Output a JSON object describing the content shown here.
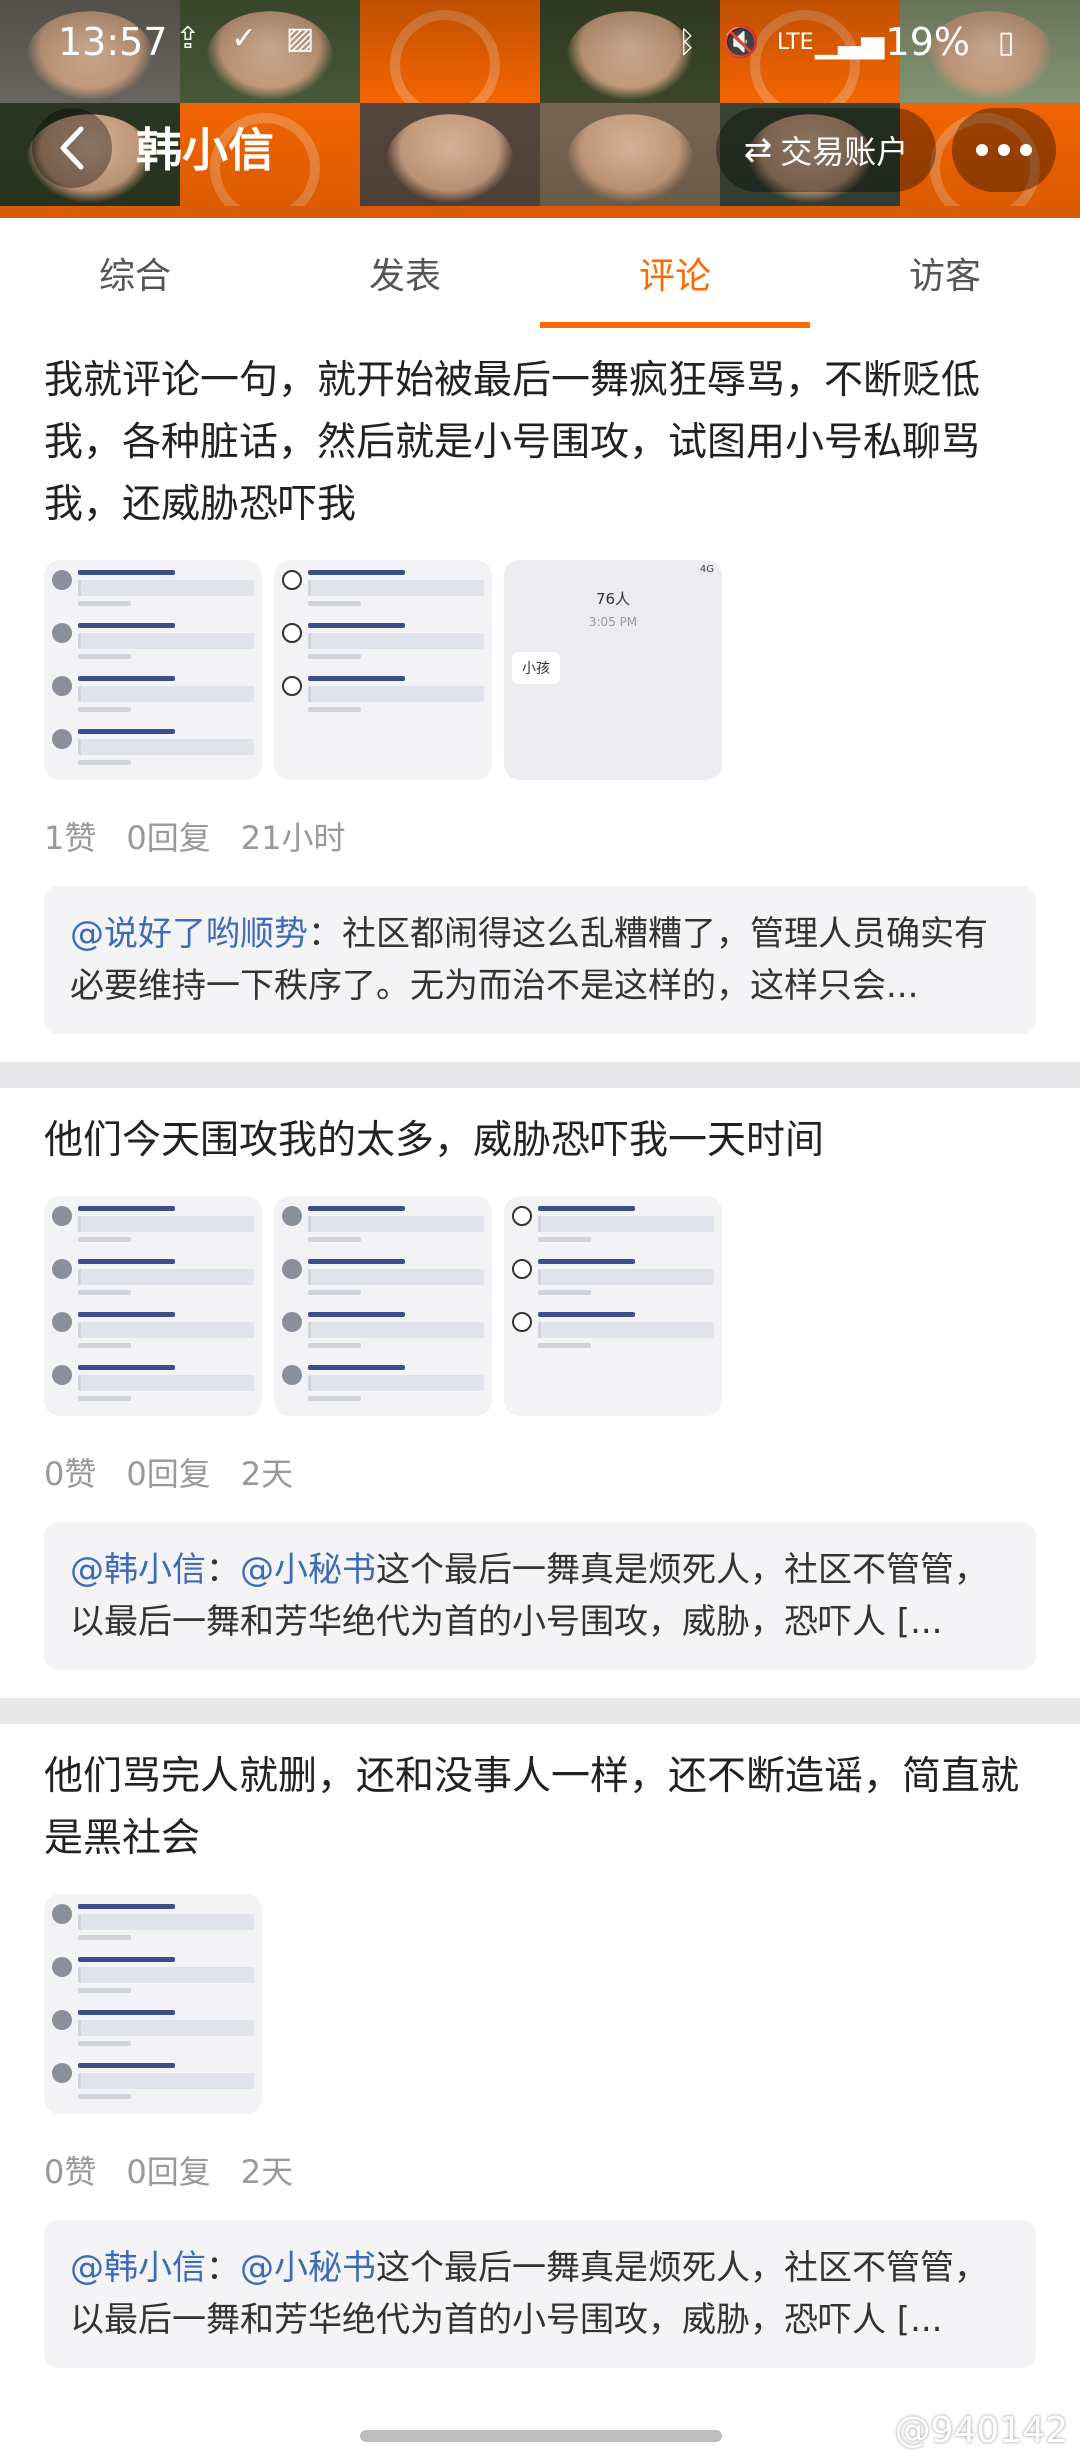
{
  "statusbar": {
    "time": "13:57",
    "lte_label": "LTE",
    "battery": "19%"
  },
  "header": {
    "title": "韩小信",
    "trade_button_label": "交易账户",
    "banner_colors": [
      "#6d6a62",
      "#4a5d3a",
      "#ff6a00",
      "#3e4a2c",
      "#ff6a00",
      "#8a9b78",
      "#2e3a24",
      "#ff6a00",
      "#5a4a40",
      "#7c6a55",
      "#3b4737",
      "#ff6a00"
    ]
  },
  "tabs": [
    {
      "label": "综合"
    },
    {
      "label": "发表"
    },
    {
      "label": "评论",
      "active": true
    },
    {
      "label": "访客"
    }
  ],
  "posts": [
    {
      "text": "我就评论一句，就开始被最后一舞疯狂辱骂，不断贬低我，各种脏话，然后就是小号围攻，试图用小号私聊骂我，还威胁恐吓我",
      "images": [
        "mentions-list",
        "mentions-cow",
        "chat"
      ],
      "chat_preview": {
        "title": "76人",
        "time": "3:05 PM",
        "bubble": "小孩",
        "mini": "4G"
      },
      "likes": "1赞",
      "replies": "0回复",
      "time": "21小时",
      "reply": {
        "author": "@说好了哟顺势",
        "sep": "：",
        "text": "社区都闹得这么乱糟糟了，管理人员确实有必要维持一下秩序了。无为而治不是这样的，这样只会..."
      }
    },
    {
      "text": "他们今天围攻我的太多，威胁恐吓我一天时间",
      "images": [
        "mentions-list",
        "mentions-mixed",
        "mentions-cow"
      ],
      "likes": "0赞",
      "replies": "0回复",
      "time": "2天",
      "reply": {
        "author": "@韩小信",
        "sep": "：",
        "mention": "@小秘书",
        "text": "这个最后一舞真是烦死人，社区不管管，以最后一舞和芳华绝代为首的小号围攻，威胁，恐吓人 [..."
      }
    },
    {
      "text": "他们骂完人就删，还和没事人一样，还不断造谣，简直就是黑社会",
      "images": [
        "mentions-list"
      ],
      "likes": "0赞",
      "replies": "0回复",
      "time": "2天",
      "reply": {
        "author": "@韩小信",
        "sep": "：",
        "mention": "@小秘书",
        "text": "这个最后一舞真是烦死人，社区不管管，以最后一舞和芳华绝代为首的小号围攻，威胁，恐吓人 [..."
      }
    }
  ],
  "watermark": "@940142"
}
